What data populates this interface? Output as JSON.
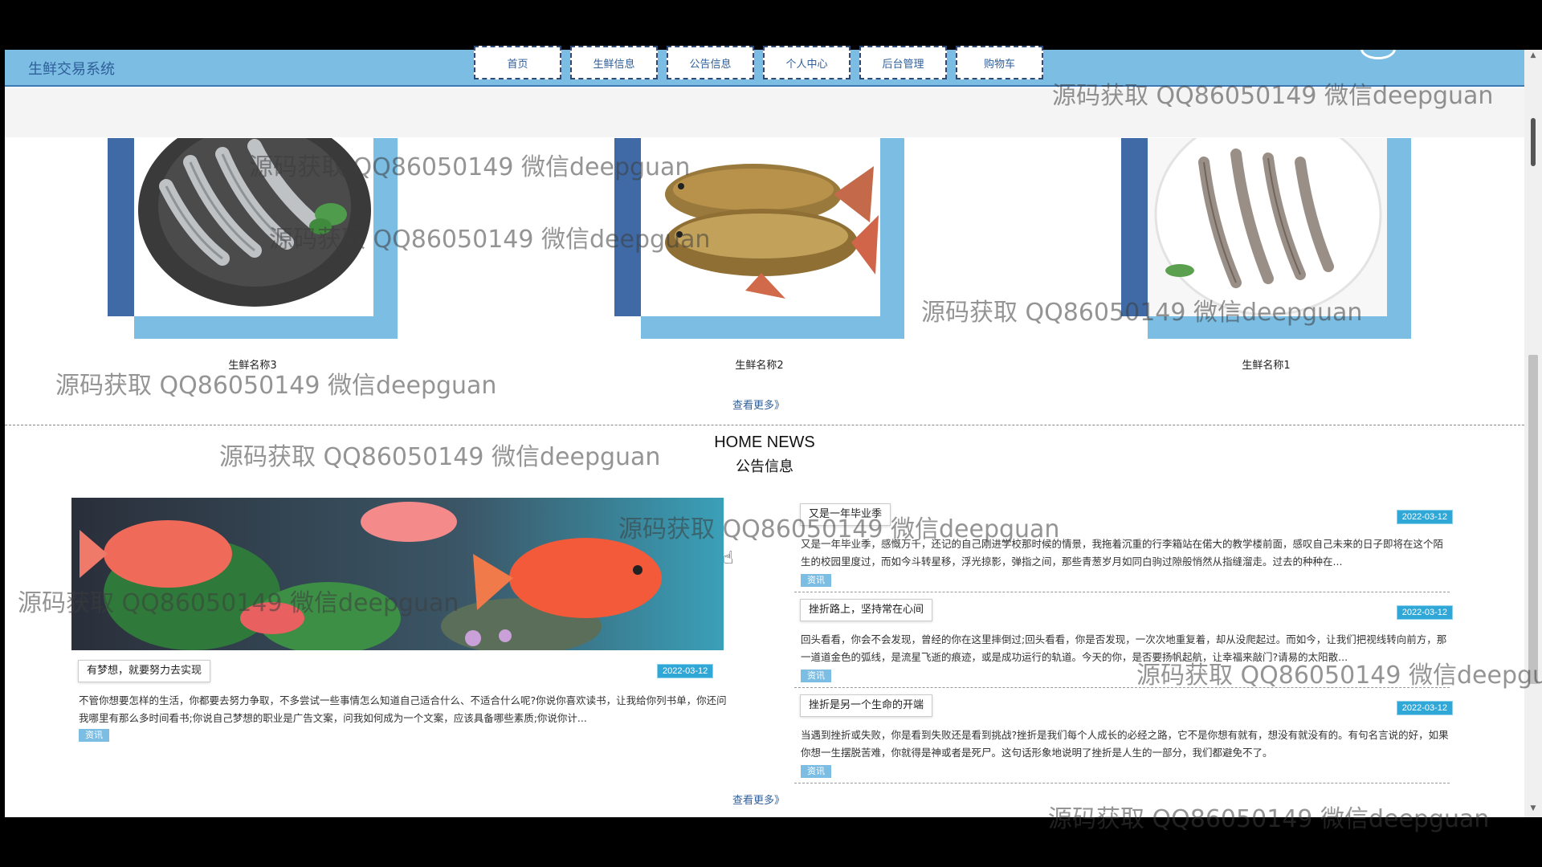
{
  "app": {
    "title": "生鲜交易系统"
  },
  "nav": [
    {
      "label": "首页"
    },
    {
      "label": "生鲜信息"
    },
    {
      "label": "公告信息"
    },
    {
      "label": "个人中心"
    },
    {
      "label": "后台管理"
    },
    {
      "label": "购物车"
    }
  ],
  "products": [
    {
      "name": "生鲜名称3",
      "image": "shrimp-plate"
    },
    {
      "name": "生鲜名称2",
      "image": "carp-fish"
    },
    {
      "name": "生鲜名称1",
      "image": "shrimp-bowl"
    }
  ],
  "products_more": "查看更多》",
  "news": {
    "heading_en": "HOME NEWS",
    "heading_cn": "公告信息",
    "featured": {
      "title": "有梦想，就要努力去实现",
      "date": "2022-03-12",
      "summary": "不管你想要怎样的生活，你都要去努力争取，不多尝试一些事情怎么知道自己适合什么、不适合什么呢?你说你喜欢读书，让我给你列书单，你还问我哪里有那么多时间看书;你说自己梦想的职业是广告文案，问我如何成为一个文案，应该具备哪些素质;你说你计...",
      "tag": "资讯",
      "image": "aquarium-fish"
    },
    "items": [
      {
        "title": "又是一年毕业季",
        "date": "2022-03-12",
        "summary": "又是一年毕业季，感慨万千，还记的自己刚进学校那时候的情景，我拖着沉重的行李箱站在偌大的教学楼前面，感叹自己未来的日子即将在这个陌生的校园里度过，而如今斗转星移，浮光掠影，弹指之间，那些青葱岁月如同白驹过隙般悄然从指缝溜走。过去的种种在...",
        "tag": "资讯"
      },
      {
        "title": "挫折路上，坚持常在心间",
        "date": "2022-03-12",
        "summary": "回头看看，你会不会发现，曾经的你在这里摔倒过;回头看看，你是否发现，一次次地重复着，却从没爬起过。而如今，让我们把视线转向前方，那一道道金色的弧线，是流星飞逝的痕迹，或是成功运行的轨道。今天的你，是否要扬帆起航，让幸福来敲门?请易的太阳散...",
        "tag": "资讯"
      },
      {
        "title": "挫折是另一个生命的开端",
        "date": "2022-03-12",
        "summary": "当遇到挫折或失败，你是看到失败还是看到挑战?挫折是我们每个人成长的必经之路，它不是你想有就有，想没有就没有的。有句名言说的好，如果你想一生摆脱苦难，你就得是神或者是死尸。这句话形象地说明了挫折是人生的一部分，我们都避免不了。",
        "tag": "资讯"
      }
    ],
    "more": "查看更多》"
  },
  "watermark": "源码获取 QQ86050149 微信deepguan",
  "colors": {
    "accent": "#7bbde3",
    "dark_accent": "#3f6aa5",
    "date_badge": "#2fa8d8"
  }
}
